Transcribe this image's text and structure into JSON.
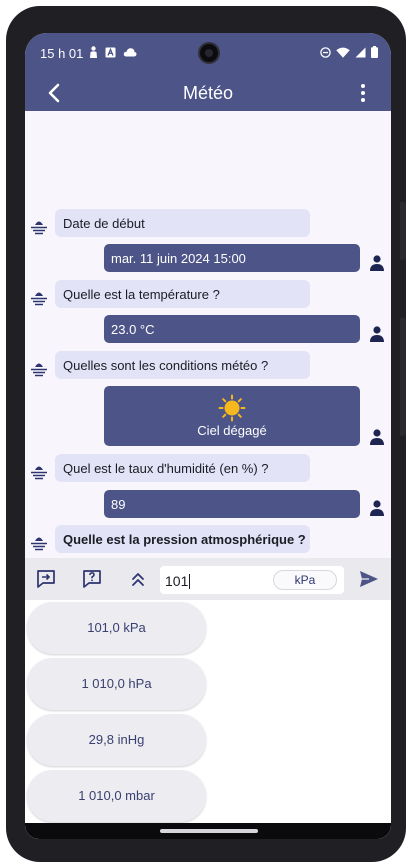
{
  "status_bar": {
    "time": "15 h 01",
    "left_icons": [
      "person-icon",
      "font-a-icon",
      "cloud-icon"
    ],
    "right_icons": [
      "do-not-disturb-icon",
      "wifi-icon",
      "signal-icon",
      "battery-icon"
    ]
  },
  "app_bar": {
    "title": "Météo",
    "back_icon": "arrow-back-icon",
    "menu_icon": "more-vert-icon"
  },
  "conversation": [
    {
      "role": "bot",
      "text": "Date de début"
    },
    {
      "role": "user",
      "text": "mar. 11 juin 2024 15:00"
    },
    {
      "role": "bot",
      "text": "Quelle est la température ?"
    },
    {
      "role": "user",
      "text": "23.0 °C"
    },
    {
      "role": "bot",
      "text": "Quelles sont les conditions météo ?"
    },
    {
      "role": "user",
      "text": "Ciel dégagé",
      "icon": "sun-icon"
    },
    {
      "role": "bot",
      "text": "Quel est le taux d'humidité (en %) ?"
    },
    {
      "role": "user",
      "text": "89"
    },
    {
      "role": "bot",
      "text": "Quelle est la pression atmosphérique ?",
      "emphasis": "bold"
    }
  ],
  "input_bar": {
    "value": "101",
    "unit": "kPa",
    "buttons": [
      "insert-comment-icon",
      "question-icon",
      "double-chevron-up-icon",
      "send-icon"
    ]
  },
  "suggestions": [
    "101,0 kPa",
    "1 010,0 hPa",
    "29,8 inHg",
    "1 010,0 mbar"
  ],
  "colors": {
    "primary": "#4c5488",
    "bot_bubble": "#e2e3f6",
    "background": "#f8f6fc",
    "toolbar": "#e9e9ee",
    "suggestion": "#ececf1",
    "sun": "#f7b81e"
  }
}
